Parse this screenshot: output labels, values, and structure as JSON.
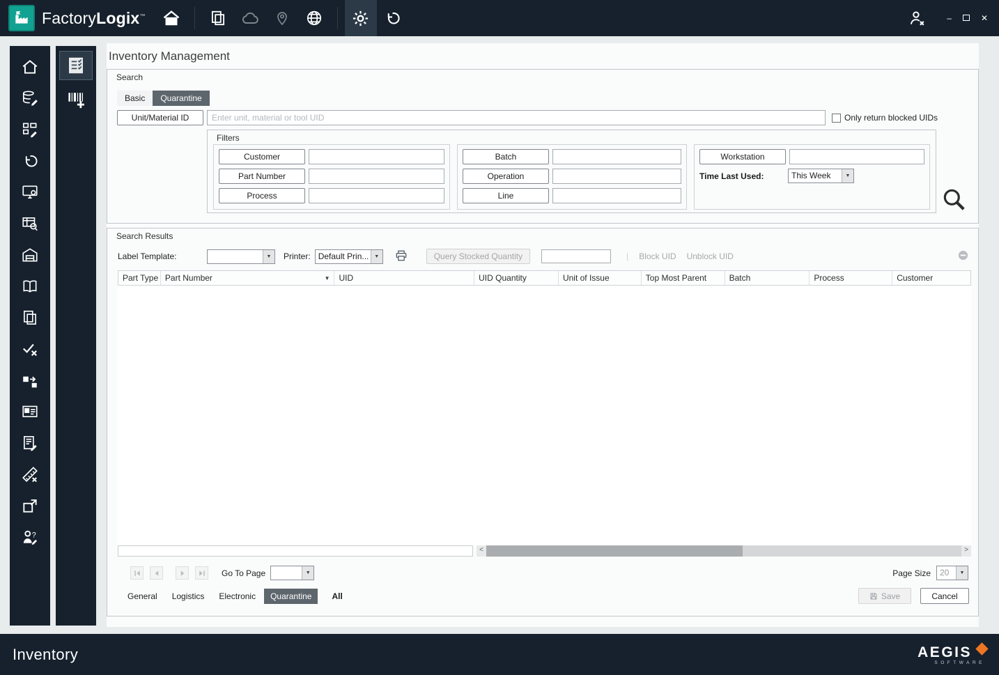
{
  "icons": {
    "dropdown_arrow": "▼",
    "sort_desc": "▼",
    "scroll_left": "<",
    "scroll_right": ">",
    "minimize": "–",
    "close": "✕",
    "separator": "|",
    "question_mark": "?",
    "topbar_icon_names": [
      "home-icon",
      "pages-icon",
      "cloud-icon",
      "location-pin-icon",
      "globe-icon",
      "settings-gear-icon",
      "history-undo-icon",
      "user-logout-icon"
    ],
    "sidebar_icon_names": [
      "home-icon",
      "database-edit-icon",
      "layout-edit-icon",
      "history-icon",
      "workstation-config-icon",
      "table-search-icon",
      "warehouse-icon",
      "book-icon",
      "pages-icon",
      "check-x-icon",
      "transfer-icon",
      "id-card-icon",
      "document-edit-icon",
      "ruler-icon",
      "package-out-icon",
      "person-question-icon"
    ],
    "subnav_icon_names": [
      "inventory-checklist-icon",
      "barcode-add-icon"
    ]
  },
  "titlebar": {
    "brand_factory": "Factory",
    "brand_logix": "Logix",
    "brand_tm": "™"
  },
  "page": {
    "title": "Inventory Management"
  },
  "search": {
    "group_label": "Search",
    "tabs": [
      {
        "label": "Basic",
        "selected": false
      },
      {
        "label": "Quarantine",
        "selected": true
      }
    ],
    "unit_button_label": "Unit/Material ID",
    "unit_input_placeholder": "Enter unit, material or tool UID",
    "unit_input_value": "",
    "blocked_checkbox_label": "Only return blocked UIDs",
    "blocked_checkbox_checked": false,
    "filters": {
      "group_label": "Filters",
      "column1": [
        {
          "button": "Customer",
          "value": ""
        },
        {
          "button": "Part Number",
          "value": ""
        },
        {
          "button": "Process",
          "value": ""
        }
      ],
      "column2": [
        {
          "button": "Batch",
          "value": ""
        },
        {
          "button": "Operation",
          "value": ""
        },
        {
          "button": "Line",
          "value": ""
        }
      ],
      "workstation_button_label": "Workstation",
      "workstation_value": "",
      "time_last_used_label": "Time Last Used:",
      "time_last_used_value": "This Week"
    }
  },
  "results": {
    "group_label": "Search Results",
    "label_template_label": "Label Template:",
    "label_template_value": "",
    "printer_label": "Printer:",
    "printer_value": "Default Prin...",
    "query_stocked_button_label": "Query Stocked Quantity",
    "quantity_value": "",
    "block_uid_label": "Block UID",
    "unblock_uid_label": "Unblock UID",
    "table": {
      "columns": [
        "Part Type",
        "Part Number",
        "UID",
        "UID Quantity",
        "Unit of Issue",
        "Top Most Parent",
        "Batch",
        "Process",
        "Customer"
      ],
      "sorted_column": "Part Number",
      "rows": []
    },
    "pager": {
      "go_to_page_label": "Go To Page",
      "go_to_page_value": "",
      "page_size_label": "Page Size",
      "page_size_value": "20"
    },
    "bottom_tabs": [
      {
        "label": "General",
        "selected": false
      },
      {
        "label": "Logistics",
        "selected": false
      },
      {
        "label": "Electronic",
        "selected": false
      },
      {
        "label": "Quarantine",
        "selected": true
      },
      {
        "label": "All",
        "selected": false
      }
    ],
    "save_button_label": "Save",
    "cancel_button_label": "Cancel"
  },
  "statusbar": {
    "module_title": "Inventory",
    "brand_name": "AEGIS",
    "brand_subtitle": "SOFTWARE"
  }
}
